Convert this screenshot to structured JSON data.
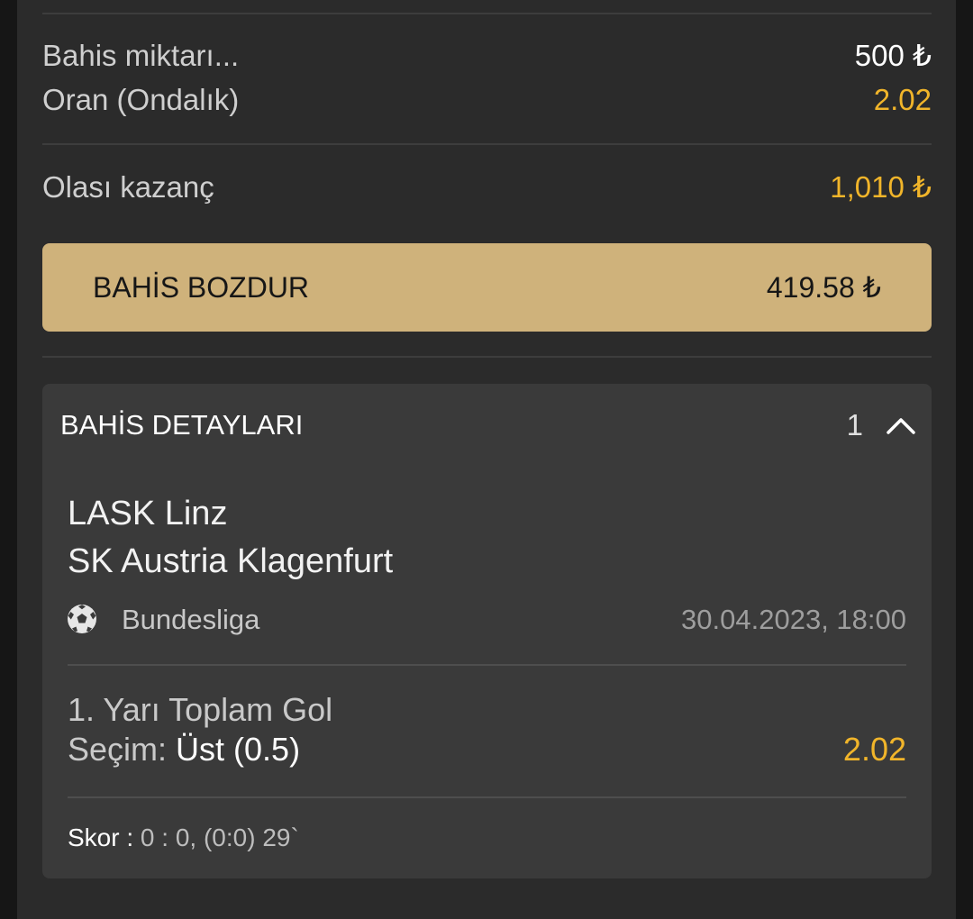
{
  "summary": {
    "stake_label": "Bahis miktarı...",
    "stake_value": "500 ₺",
    "odds_label": "Oran (Ondalık)",
    "odds_value": "2.02",
    "win_label": "Olası kazanç",
    "win_value": "1,010 ₺"
  },
  "cashout": {
    "label": "BAHİS BOZDUR",
    "value": "419.58 ₺"
  },
  "details": {
    "title": "BAHİS DETAYLARI",
    "count": "1",
    "toggle_icon": "chevron-up-icon",
    "team_home": "LASK Linz",
    "team_away": "SK Austria Klagenfurt",
    "sport_icon": "soccer-ball-icon",
    "league": "Bundesliga",
    "date": "30.04.2023, 18:00",
    "market": "1. Yarı Toplam Gol",
    "selection_label": "Seçim:",
    "selection_value": "Üst (0.5)",
    "selection_odds": "2.02",
    "score_label": "Skor :",
    "score_value": "0 : 0, (0:0) 29`"
  },
  "colors": {
    "background": "#161616",
    "panel": "#2b2b2b",
    "card": "#3a3a3a",
    "accent_gold": "#f1b52a",
    "cashout_button": "#cfb27b"
  }
}
